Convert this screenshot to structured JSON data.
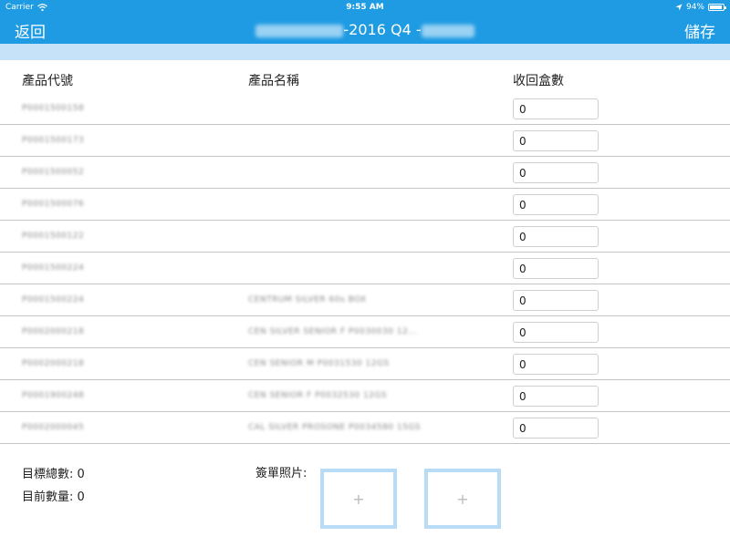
{
  "status_bar": {
    "carrier": "Carrier",
    "time": "9:55 AM",
    "battery": "94%",
    "battery_level": 0.94
  },
  "nav": {
    "back_label": "返回",
    "save_label": "儲存",
    "title_visible": "-2016 Q4 -"
  },
  "table": {
    "headers": {
      "code": "產品代號",
      "name": "產品名稱",
      "qty": "收回盒數"
    },
    "rows": [
      {
        "code": "P0001500158",
        "name": "",
        "qty": "0"
      },
      {
        "code": "P0001500173",
        "name": "",
        "qty": "0"
      },
      {
        "code": "P0001500052",
        "name": "",
        "qty": "0"
      },
      {
        "code": "P0001500076",
        "name": "",
        "qty": "0"
      },
      {
        "code": "P0001500122",
        "name": "",
        "qty": "0"
      },
      {
        "code": "P0001500224",
        "name": "",
        "qty": "0"
      },
      {
        "code": "P0001500224",
        "name": "CENTRUM SILVER 60s BOX",
        "qty": "0"
      },
      {
        "code": "P0002000218",
        "name": "CEN SILVER SENIOR F P0030030 12...",
        "qty": "0"
      },
      {
        "code": "P0002000218",
        "name": "CEN SENIOR M P0031530 12GS",
        "qty": "0"
      },
      {
        "code": "P0001900248",
        "name": "CEN SENIOR F P0032530 12GS",
        "qty": "0"
      },
      {
        "code": "P0002000045",
        "name": "CAL SILVER PROSONE P0034580 15GS",
        "qty": "0"
      }
    ]
  },
  "footer": {
    "target_total_label": "目標總數:",
    "target_total_value": "0",
    "current_qty_label": "目前數量:",
    "current_qty_value": "0",
    "photo_label": "簽單照片:",
    "photo_add_symbol": "+"
  },
  "colors": {
    "nav_bg": "#1e9be3",
    "subbar_bg": "#c6e2f8",
    "photo_border": "#b9dcf6"
  }
}
